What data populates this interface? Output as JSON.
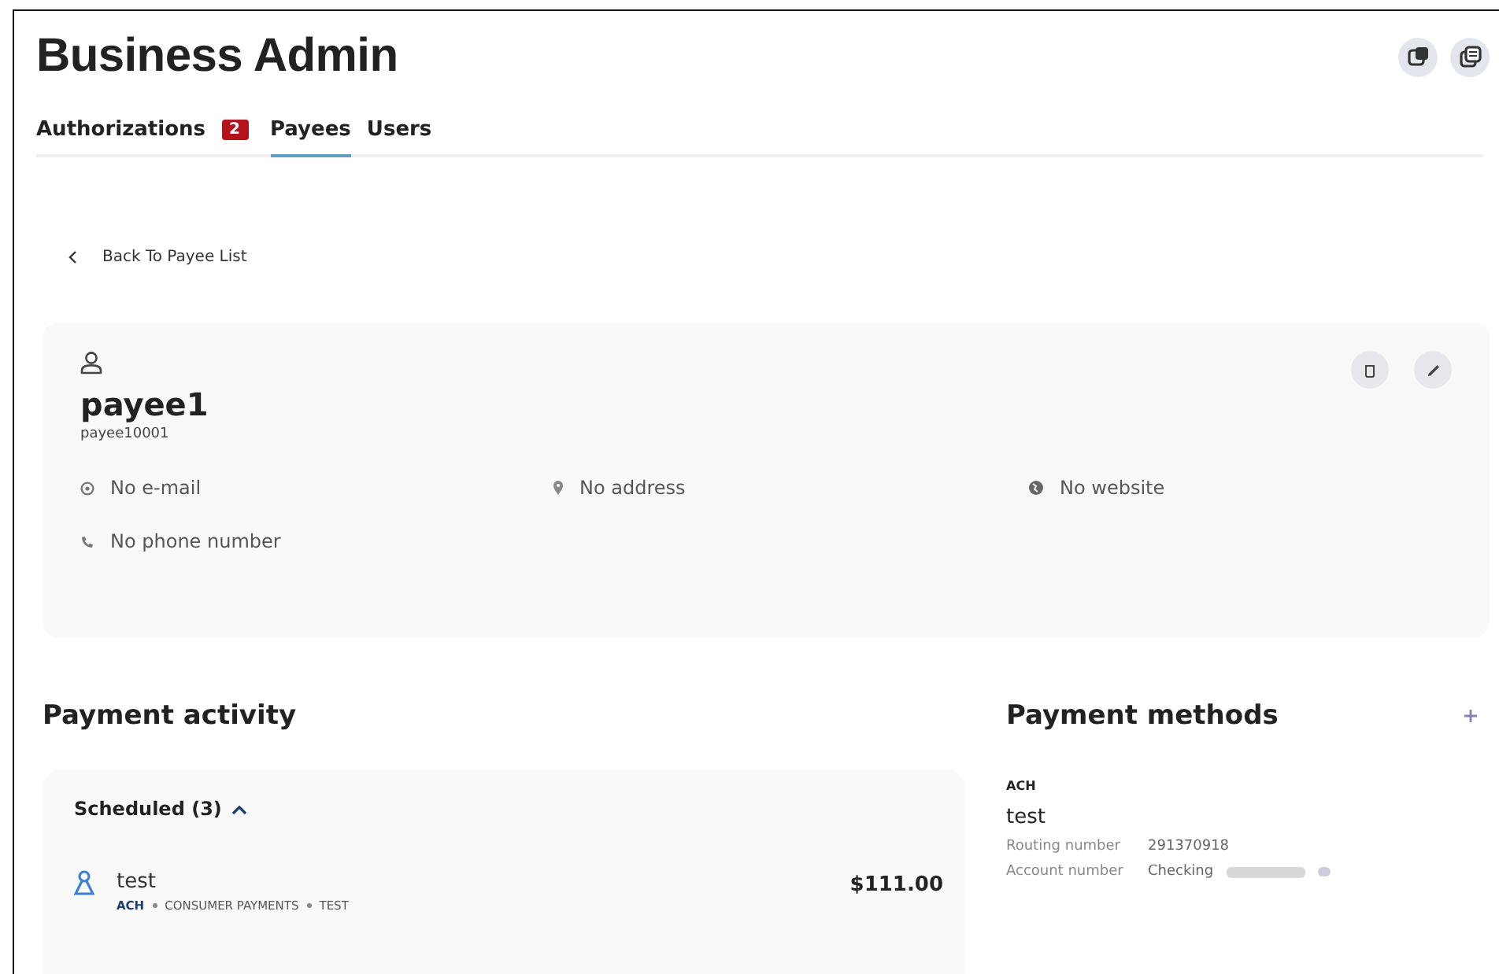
{
  "header": {
    "title": "Business Admin"
  },
  "tabs": [
    {
      "label": "Authorizations",
      "badge": "2",
      "selected": false
    },
    {
      "label": "Payees",
      "selected": true
    },
    {
      "label": "Users",
      "selected": false
    }
  ],
  "back_link": "Back To Payee List",
  "payee": {
    "name": "payee1",
    "id": "payee10001",
    "email": "No e-mail",
    "address": "No address",
    "website": "No website",
    "phone": "No phone number"
  },
  "payment_activity": {
    "title": "Payment activity",
    "group": {
      "label": "Scheduled (3)",
      "expanded": true
    },
    "items": [
      {
        "name": "test",
        "amount": "$111.00",
        "tags": [
          "ACH",
          "CONSUMER PAYMENTS",
          "TEST"
        ]
      }
    ]
  },
  "payment_methods": {
    "title": "Payment methods",
    "items": [
      {
        "type": "ACH",
        "name": "test",
        "routing_label": "Routing number",
        "routing": "291370918",
        "account_label": "Account number",
        "account": "Checking"
      }
    ]
  }
}
